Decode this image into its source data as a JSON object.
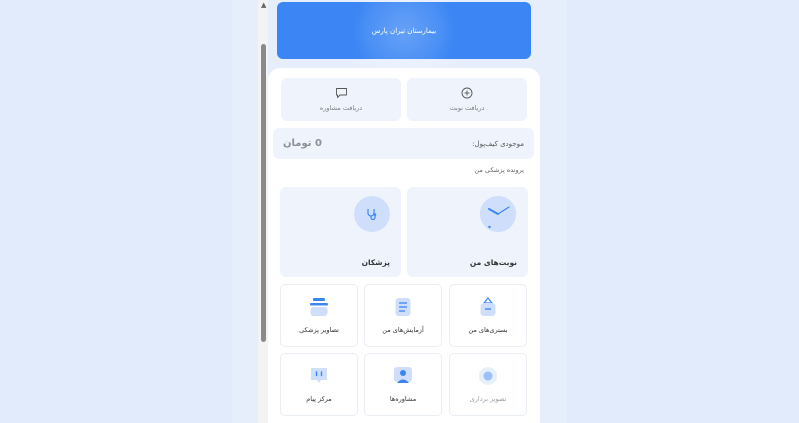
{
  "banner": {
    "title": "بیمارستان تیران پارس"
  },
  "actions": [
    {
      "label": "دریافت نوبت",
      "icon": "plus-circle-icon"
    },
    {
      "label": "دریافت مشاوره",
      "icon": "chat-icon"
    }
  ],
  "wallet": {
    "label": "موجودی کیف‌پول:",
    "amount": "0 تومان"
  },
  "section": {
    "title": "پرونده پزشکی من"
  },
  "big_cards": [
    {
      "label": "نوبت‌های من",
      "icon": "clock-icon"
    },
    {
      "label": "پزشکان",
      "icon": "stethoscope-icon"
    }
  ],
  "grid": [
    {
      "label": "بستری‌های من",
      "icon": "hospital-bag-icon"
    },
    {
      "label": "آزمایش‌های من",
      "icon": "lab-report-icon"
    },
    {
      "label": "تصاویر پزشکی",
      "icon": "medical-image-icon"
    },
    {
      "label": "تصویر برداری",
      "icon": "imaging-icon"
    },
    {
      "label": "مشاوره‌ها",
      "icon": "consultant-icon"
    },
    {
      "label": "مرکز پیام",
      "icon": "message-icon"
    }
  ],
  "colors": {
    "accent": "#3b86f4",
    "card_bg": "#eef3fc",
    "icon_bg": "#cfdffb"
  }
}
